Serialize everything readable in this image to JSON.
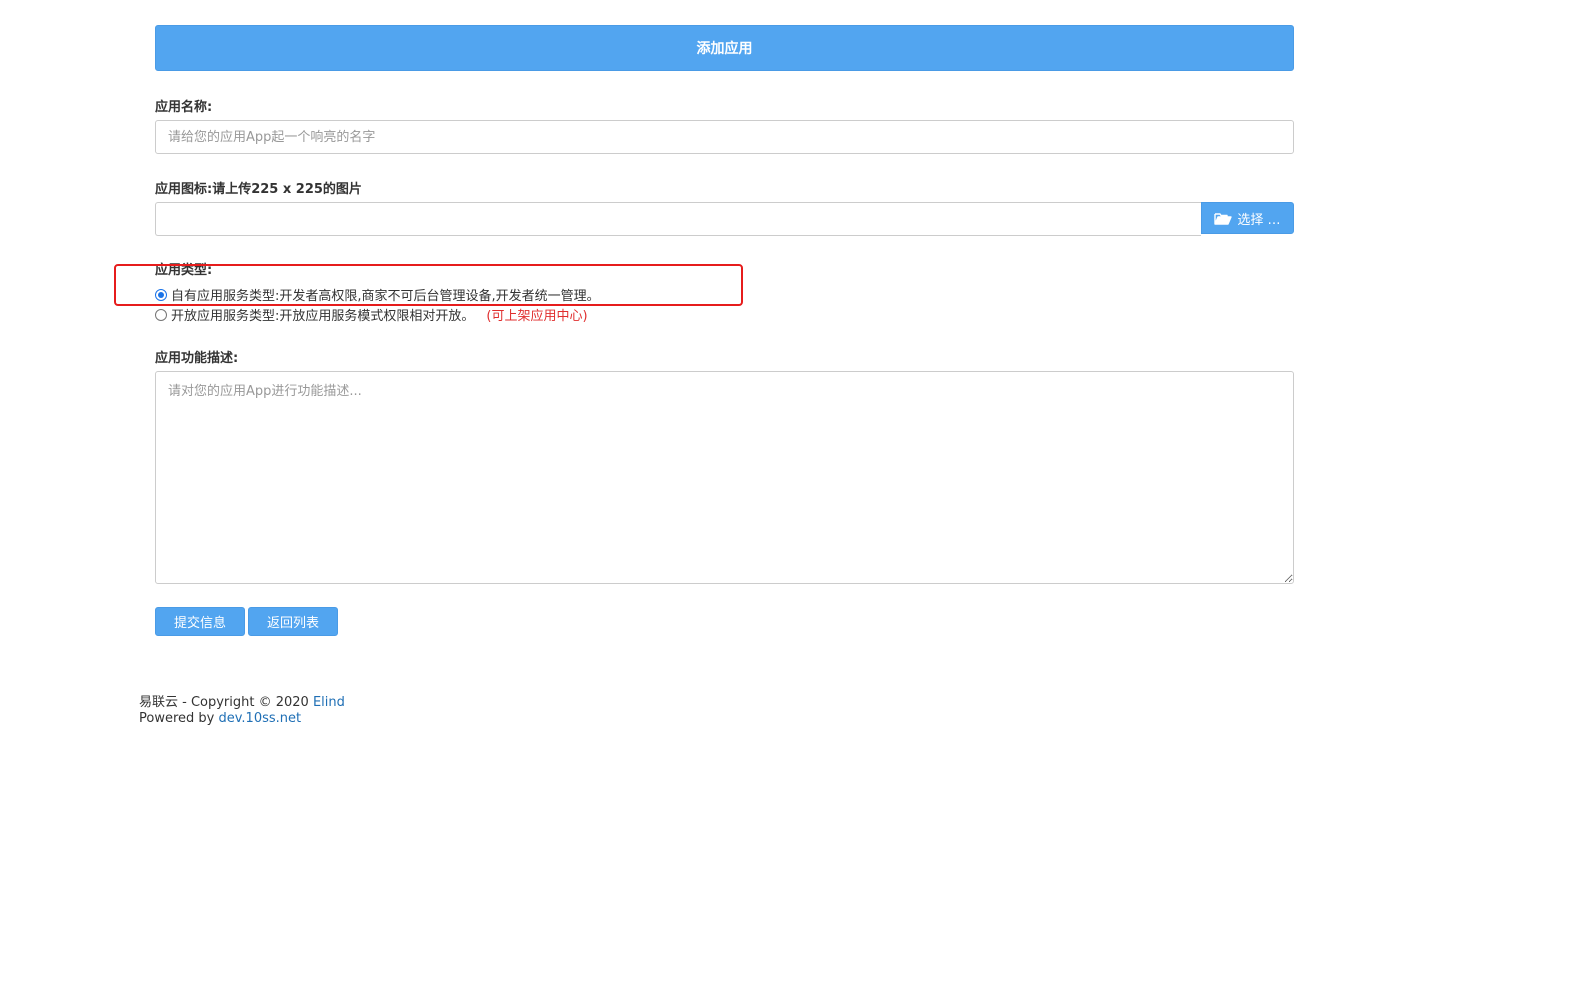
{
  "header": {
    "title": "添加应用"
  },
  "form": {
    "name_label": "应用名称:",
    "name_placeholder": "请给您的应用App起一个响亮的名字",
    "icon_label": "应用图标:请上传225 x 225的图片",
    "file_button_label": "选择 …",
    "type_label": "应用类型:",
    "type_options": [
      {
        "label": "自有应用服务类型:开发者高权限,商家不可后台管理设备,开发者统一管理。",
        "checked": true,
        "note": ""
      },
      {
        "label": "开放应用服务类型:开放应用服务模式权限相对开放。",
        "checked": false,
        "note": "(可上架应用中心)"
      }
    ],
    "description_label": "应用功能描述:",
    "description_placeholder": "请对您的应用App进行功能描述...",
    "submit_label": "提交信息",
    "back_label": "返回列表"
  },
  "footer": {
    "copyright_prefix": "易联云 - Copyright © 2020 ",
    "copyright_link": "Elind",
    "powered_prefix": "Powered by ",
    "powered_link": "dev.10ss.net"
  },
  "colors": {
    "primary": "#52a5f0",
    "highlight": "#e61c1c",
    "note": "#e02e2e",
    "link": "#1f6fb5"
  },
  "icons": {
    "file_button": "folder-open-icon"
  }
}
